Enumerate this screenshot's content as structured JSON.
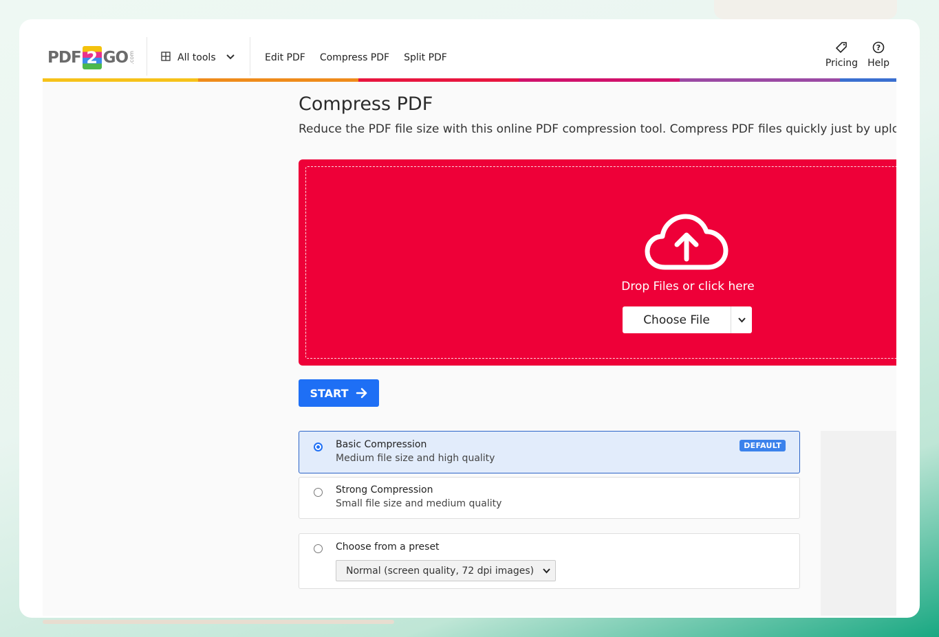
{
  "header": {
    "logo": {
      "left": "PDF",
      "mid": "2",
      "right": "GO",
      "suffix": ".com"
    },
    "all_tools_label": "All tools",
    "nav_links": [
      "Edit PDF",
      "Compress PDF",
      "Split PDF"
    ],
    "pricing_label": "Pricing",
    "help_label": "Help",
    "color_bar": [
      "#f6c21a",
      "#ef8b1b",
      "#e8163f",
      "#d0116b",
      "#9b4aa4",
      "#3a6fd0"
    ]
  },
  "main": {
    "title": "Compress PDF",
    "description": "Reduce the PDF file size with this online PDF compression tool. Compress PDF files quickly just by uploading",
    "dropzone": {
      "text": "Drop Files or click here",
      "choose_file_label": "Choose File",
      "icon": "cloud-upload-icon",
      "color": "#ee0038"
    },
    "start_label": "START",
    "options": [
      {
        "title": "Basic Compression",
        "subtitle": "Medium file size and high quality",
        "badge": "DEFAULT",
        "selected": true
      },
      {
        "title": "Strong Compression",
        "subtitle": "Small file size and medium quality",
        "selected": false
      },
      {
        "title": "Choose from a preset",
        "selected": false,
        "preset_value": "Normal (screen quality, 72 dpi images)"
      }
    ]
  },
  "colors": {
    "accent": "#1e6ff5",
    "brand_red": "#ee0038"
  }
}
